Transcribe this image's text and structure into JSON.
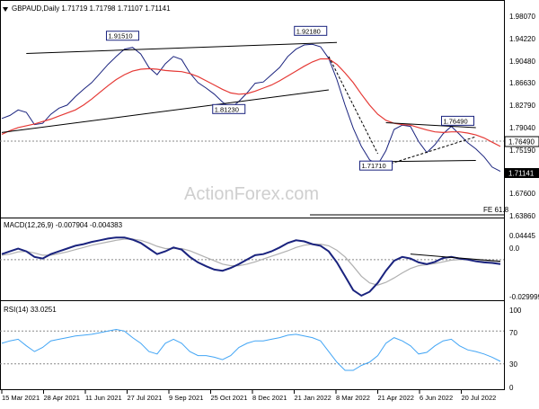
{
  "header": {
    "symbol_line": "GBPAUD,Daily  1.71719 1.71798 1.71107 1.71141",
    "triangle_icon": "triangle-down-icon"
  },
  "watermark": "ActionForex.com",
  "colors": {
    "price": "#1a237e",
    "ma": "#e53935",
    "macd": "#1a237e",
    "signal": "#b0b0b0",
    "rsi": "#42a5f5"
  },
  "price_panel": {
    "y_ticks": [
      "1.98070",
      "1.94220",
      "1.90480",
      "1.86630",
      "1.82790",
      "1.79040",
      "1.75190",
      "1.71141",
      "1.67600",
      "1.63860"
    ],
    "last_price_label": "1.71141",
    "level_label": "1.76490",
    "fe_label": "FE 61.8",
    "annotations": [
      "1.91510",
      "1.92180",
      "1.81230",
      "1.71710",
      "1.76490"
    ]
  },
  "macd_panel": {
    "title": "MACD(12,26,9) -0.007904 -0.004383",
    "y_ticks": [
      "0.04445",
      "0.0",
      "-0.029999"
    ]
  },
  "rsi_panel": {
    "title": "RSI(14) 33.0251",
    "y_ticks": [
      "100",
      "70",
      "30",
      "0"
    ]
  },
  "x_axis": {
    "labels": [
      "15 Mar 2021",
      "28 Apr 2021",
      "11 Jun 2021",
      "27 Jul 2021",
      "9 Sep 2021",
      "25 Oct 2021",
      "8 Dec 2021",
      "21 Jan 2022",
      "8 Mar 2022",
      "21 Apr 2022",
      "6 Jun 2022",
      "20 Jul 2022"
    ]
  },
  "chart_data": [
    {
      "type": "line",
      "panel": "price",
      "title": "GBPAUD,Daily",
      "series": [
        {
          "name": "GBPAUD close",
          "values": [
            1.798,
            1.803,
            1.812,
            1.808,
            1.788,
            1.79,
            1.805,
            1.815,
            1.82,
            1.834,
            1.846,
            1.857,
            1.872,
            1.887,
            1.9,
            1.912,
            1.915,
            1.904,
            1.882,
            1.87,
            1.888,
            1.9,
            1.895,
            1.873,
            1.857,
            1.848,
            1.838,
            1.825,
            1.815,
            1.826,
            1.84,
            1.856,
            1.858,
            1.87,
            1.882,
            1.9,
            1.912,
            1.919,
            1.92,
            1.916,
            1.897,
            1.862,
            1.82,
            1.782,
            1.752,
            1.73,
            1.722,
            1.745,
            1.78,
            1.787,
            1.785,
            1.76,
            1.742,
            1.755,
            1.773,
            1.785,
            1.772,
            1.758,
            1.748,
            1.735,
            1.718,
            1.711
          ]
        },
        {
          "name": "MA",
          "values": [
            1.772,
            1.778,
            1.783,
            1.786,
            1.789,
            1.793,
            1.797,
            1.802,
            1.807,
            1.812,
            1.82,
            1.83,
            1.841,
            1.852,
            1.862,
            1.87,
            1.876,
            1.879,
            1.88,
            1.879,
            1.877,
            1.876,
            1.875,
            1.872,
            1.867,
            1.86,
            1.853,
            1.846,
            1.84,
            1.838,
            1.839,
            1.843,
            1.848,
            1.853,
            1.86,
            1.868,
            1.876,
            1.884,
            1.891,
            1.896,
            1.896,
            1.887,
            1.873,
            1.857,
            1.838,
            1.82,
            1.805,
            1.795,
            1.79,
            1.788,
            1.787,
            1.783,
            1.779,
            1.776,
            1.775,
            1.776,
            1.776,
            1.774,
            1.771,
            1.766,
            1.759,
            1.752
          ]
        }
      ],
      "ylim": [
        1.635,
        1.99
      ],
      "annotations": [
        {
          "label": "1.91510",
          "index": 15
        },
        {
          "label": "1.92180",
          "index": 38
        },
        {
          "label": "1.81230",
          "index": 28
        },
        {
          "label": "1.71710",
          "index": 46
        },
        {
          "label": "1.76490",
          "index": 56
        }
      ]
    },
    {
      "type": "line",
      "panel": "macd",
      "title": "MACD(12,26,9)",
      "series": [
        {
          "name": "MACD",
          "values": [
            0.01,
            0.015,
            0.02,
            0.015,
            0.005,
            0.002,
            0.01,
            0.015,
            0.02,
            0.025,
            0.028,
            0.032,
            0.035,
            0.038,
            0.04,
            0.04,
            0.036,
            0.03,
            0.02,
            0.01,
            0.015,
            0.022,
            0.018,
            0.005,
            -0.005,
            -0.012,
            -0.018,
            -0.02,
            -0.015,
            -0.008,
            0.0,
            0.008,
            0.01,
            0.015,
            0.022,
            0.03,
            0.035,
            0.033,
            0.028,
            0.025,
            0.015,
            -0.005,
            -0.03,
            -0.055,
            -0.065,
            -0.058,
            -0.042,
            -0.02,
            -0.002,
            0.005,
            0.002,
            -0.005,
            -0.008,
            -0.004,
            0.003,
            0.005,
            0.002,
            0.0,
            -0.003,
            -0.005,
            -0.006,
            -0.008
          ]
        },
        {
          "name": "Signal",
          "values": [
            0.008,
            0.01,
            0.014,
            0.015,
            0.012,
            0.008,
            0.008,
            0.011,
            0.014,
            0.018,
            0.022,
            0.026,
            0.029,
            0.032,
            0.035,
            0.037,
            0.037,
            0.035,
            0.03,
            0.024,
            0.02,
            0.02,
            0.02,
            0.016,
            0.01,
            0.004,
            -0.002,
            -0.008,
            -0.011,
            -0.011,
            -0.008,
            -0.004,
            0.001,
            0.006,
            0.011,
            0.016,
            0.022,
            0.026,
            0.028,
            0.028,
            0.025,
            0.017,
            0.005,
            -0.012,
            -0.03,
            -0.042,
            -0.046,
            -0.041,
            -0.033,
            -0.024,
            -0.016,
            -0.011,
            -0.009,
            -0.007,
            -0.004,
            -0.001,
            0.0,
            0.0,
            -0.001,
            -0.002,
            -0.003,
            -0.004
          ]
        }
      ],
      "ylim": [
        -0.07,
        0.05
      ]
    },
    {
      "type": "line",
      "panel": "rsi",
      "title": "RSI(14)",
      "series": [
        {
          "name": "RSI",
          "values": [
            55,
            58,
            60,
            52,
            45,
            50,
            58,
            60,
            62,
            64,
            65,
            66,
            68,
            70,
            72,
            70,
            62,
            55,
            45,
            42,
            55,
            60,
            55,
            45,
            40,
            40,
            38,
            35,
            40,
            50,
            55,
            58,
            58,
            60,
            62,
            65,
            66,
            64,
            62,
            58,
            45,
            32,
            22,
            22,
            28,
            32,
            40,
            55,
            62,
            58,
            52,
            42,
            44,
            52,
            58,
            60,
            52,
            47,
            45,
            42,
            38,
            33
          ]
        }
      ],
      "ylim": [
        0,
        100
      ],
      "levels": [
        70,
        30
      ]
    }
  ]
}
